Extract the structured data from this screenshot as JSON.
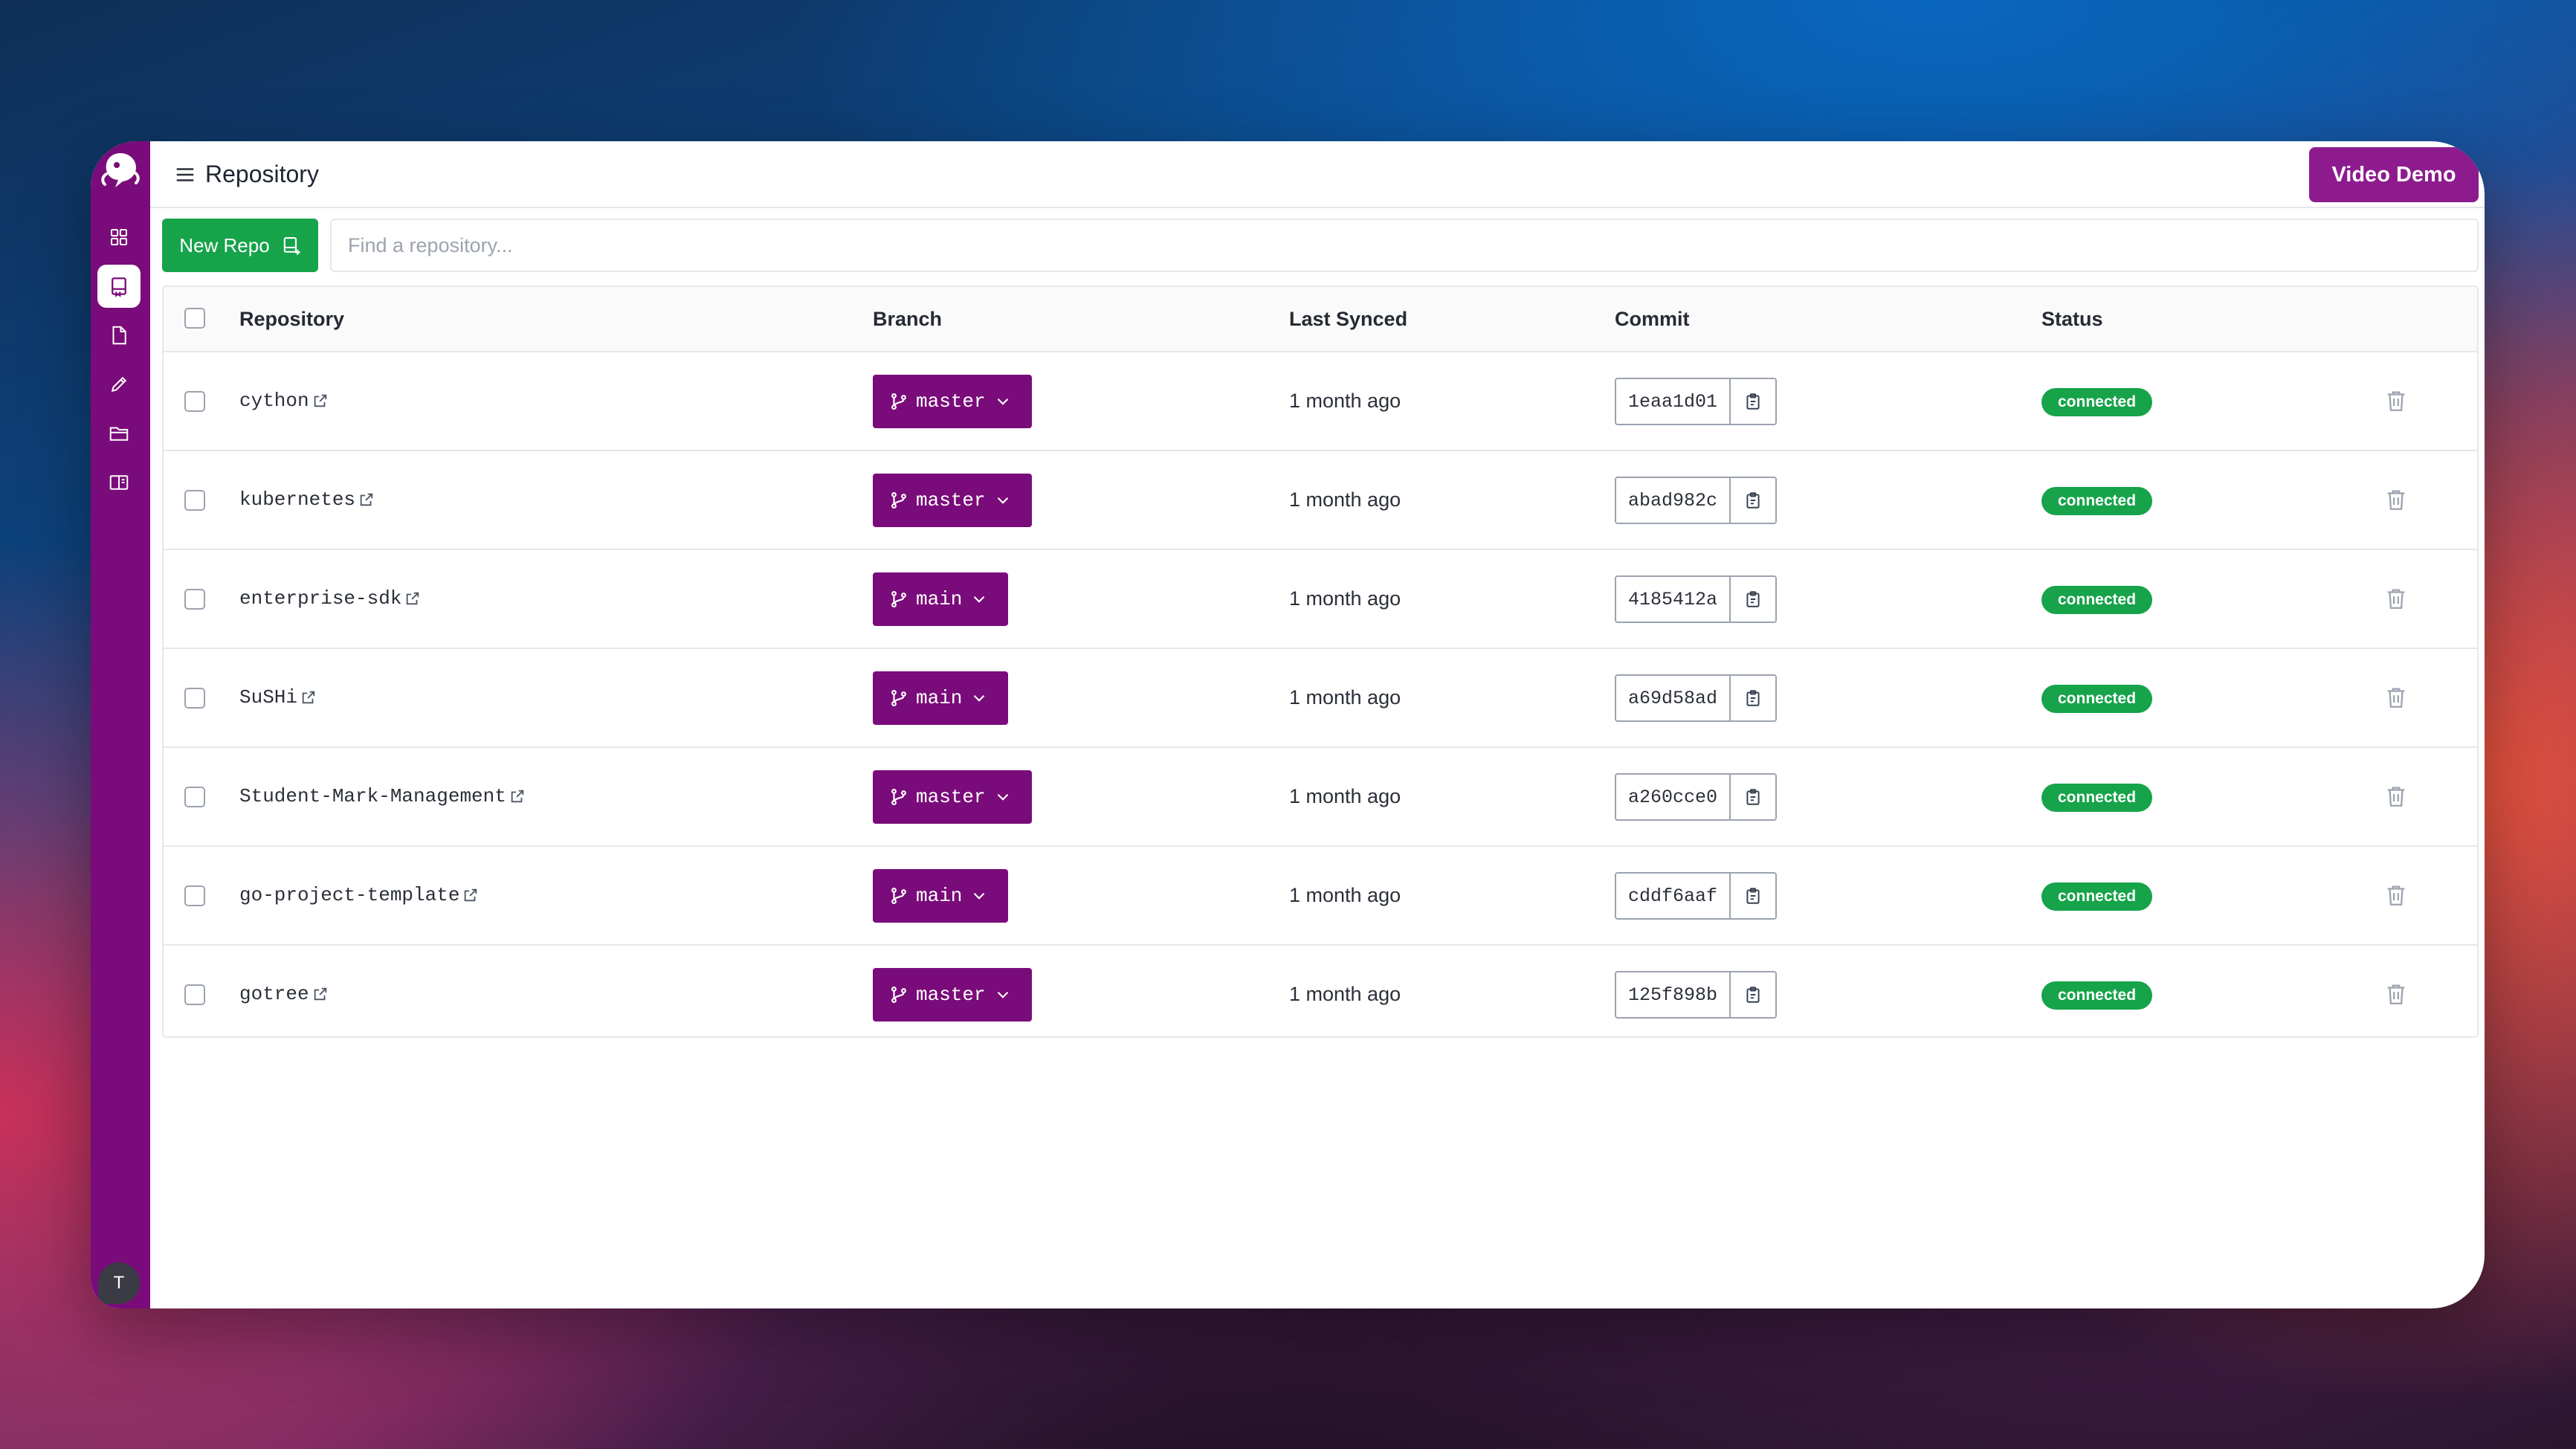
{
  "header": {
    "title": "Repository",
    "video_demo_label": "Video Demo"
  },
  "sidebar": {
    "items": [
      {
        "name": "dashboard",
        "icon": "grid-icon"
      },
      {
        "name": "repository",
        "icon": "repo-icon",
        "active": true
      },
      {
        "name": "documents",
        "icon": "file-icon"
      },
      {
        "name": "editor",
        "icon": "pencil-icon"
      },
      {
        "name": "folders",
        "icon": "folder-icon"
      },
      {
        "name": "library",
        "icon": "book-icon"
      }
    ],
    "avatar_letter": "T"
  },
  "toolbar": {
    "new_repo_label": "New Repo",
    "search_placeholder": "Find a repository..."
  },
  "table": {
    "columns": [
      "Repository",
      "Branch",
      "Last Synced",
      "Commit",
      "Status"
    ],
    "rows": [
      {
        "name": "cython",
        "branch": "master",
        "synced": "1 month ago",
        "commit": "1eaa1d01",
        "status": "connected"
      },
      {
        "name": "kubernetes",
        "branch": "master",
        "synced": "1 month ago",
        "commit": "abad982c",
        "status": "connected"
      },
      {
        "name": "enterprise-sdk",
        "branch": "main",
        "synced": "1 month ago",
        "commit": "4185412a",
        "status": "connected"
      },
      {
        "name": "SuSHi",
        "branch": "main",
        "synced": "1 month ago",
        "commit": "a69d58ad",
        "status": "connected"
      },
      {
        "name": "Student-Mark-Management",
        "branch": "master",
        "synced": "1 month ago",
        "commit": "a260cce0",
        "status": "connected"
      },
      {
        "name": "go-project-template",
        "branch": "main",
        "synced": "1 month ago",
        "commit": "cddf6aaf",
        "status": "connected"
      },
      {
        "name": "gotree",
        "branch": "master",
        "synced": "1 month ago",
        "commit": "125f898b",
        "status": "connected"
      }
    ]
  },
  "colors": {
    "brand": "#7a0b7a",
    "accent": "#8e1b8e",
    "success": "#16a34a"
  }
}
